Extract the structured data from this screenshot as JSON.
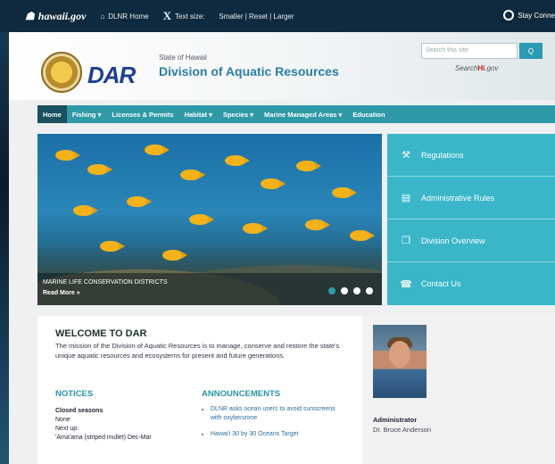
{
  "topbar": {
    "brand": "hawaii.gov",
    "items": [
      {
        "label": "DLNR Home",
        "icon": "home-icon"
      },
      {
        "label": "Text size:",
        "icon": "text-size-icon"
      },
      {
        "label": "Smaller | Reset | Larger",
        "icon": ""
      }
    ],
    "stay": "Stay Conne"
  },
  "header": {
    "logo_text": "DAR",
    "state": "State of Hawaii",
    "title": "Division of Aquatic Resources",
    "search_placeholder": "Search this site",
    "search_button": "Q",
    "search_hi_prefix": "Search",
    "search_hi_brand": "Hi",
    "search_hi_suffix": ".gov"
  },
  "nav": [
    "Home",
    "Fishing ▾",
    "Licenses & Permits",
    "Habitat ▾",
    "Species ▾",
    "Marine Managed Areas ▾",
    "Education"
  ],
  "hero": {
    "caption": "MARINE LIFE CONSERVATION DISTRICTS",
    "read_more": "Read More »",
    "active_slide": 1,
    "slide_count": 4
  },
  "quick_links": [
    {
      "label": "Regulations",
      "icon": "gavel-icon"
    },
    {
      "label": "Administrative Rules",
      "icon": "document-icon"
    },
    {
      "label": "Division Overview",
      "icon": "copy-icon"
    },
    {
      "label": "Contact Us",
      "icon": "phone-icon"
    }
  ],
  "welcome": {
    "heading": "WELCOME TO DAR",
    "intro": "The mission of the Division of Aquatic Resources is to manage, conserve and restore the state's unique aquatic resources and ecosystems for present and future generations.",
    "notices_heading": "NOTICES",
    "notices": [
      {
        "text": "Closed seasons",
        "bold": true
      },
      {
        "text": "None",
        "bold": false
      },
      {
        "text": "Next up:",
        "bold": false
      },
      {
        "text": "'Ama'ama (striped mullet) Dec-Mar",
        "bold": false
      }
    ],
    "announcements_heading": "ANNOUNCEMENTS",
    "announcements": [
      "DLNR asks ocean users to avoid sunscreens with oxybenzone",
      "Hawai'i 30 by 30 Oceans Target"
    ]
  },
  "admin": {
    "role": "Administrator",
    "name": "Dr. Bruce Anderson"
  },
  "colors": {
    "teal": "#2f9aa7",
    "quick_bg": "#3ab6c8",
    "topbar": "#0f2a3f"
  }
}
